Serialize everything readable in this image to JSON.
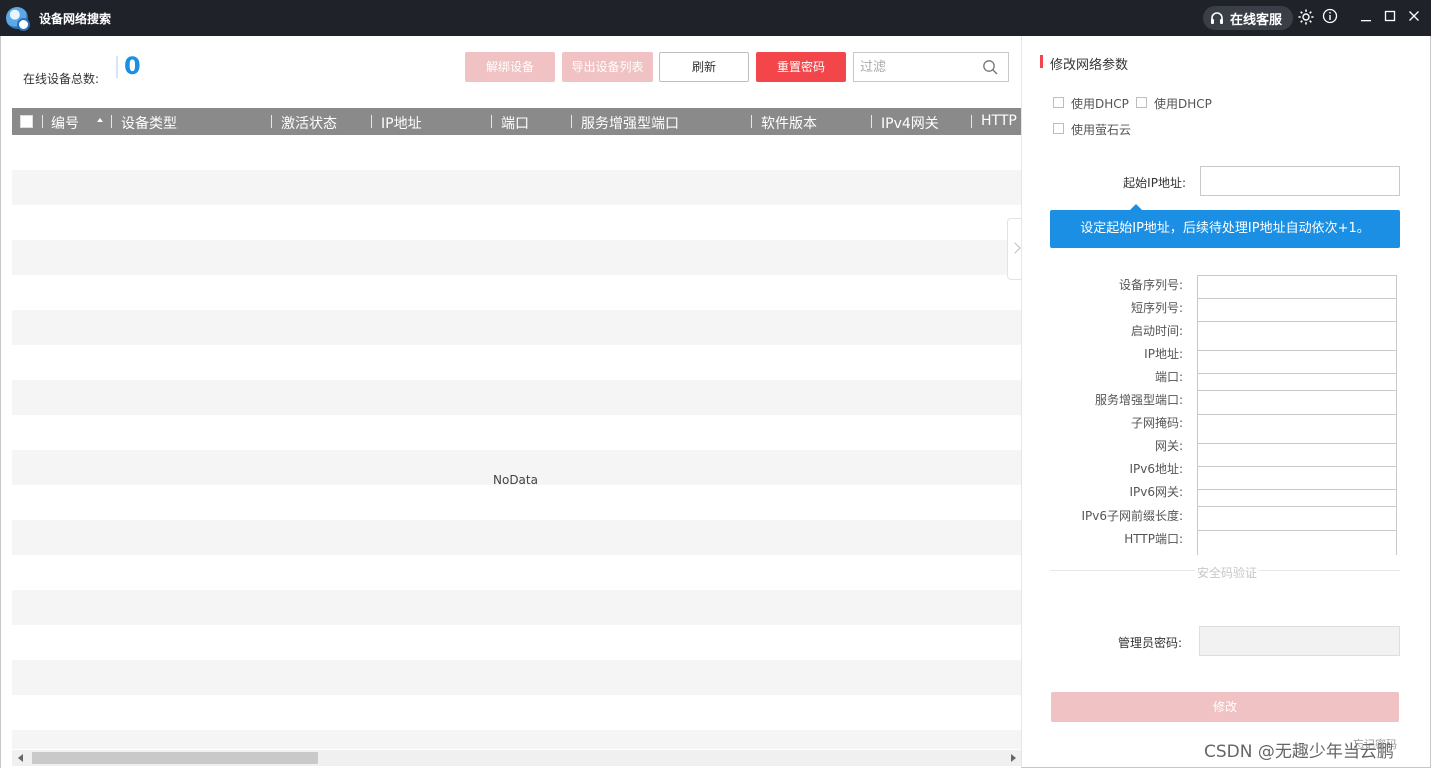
{
  "app": {
    "title": "设备网络搜索",
    "service_label": "在线客服"
  },
  "colors": {
    "accent_blue": "#1a8fe3",
    "danger_red": "#f2464a",
    "disabled_red": "#f0c2c4",
    "titlebar": "#1f2329"
  },
  "summary": {
    "label": "在线设备总数:",
    "count": "0"
  },
  "toolbar": {
    "unbind_label": "解绑设备",
    "export_label": "导出设备列表",
    "refresh_label": "刷新",
    "reset_label": "重置密码",
    "filter_placeholder": "过滤"
  },
  "table": {
    "columns": [
      "编号",
      "设备类型",
      "激活状态",
      "IP地址",
      "端口",
      "服务增强型端口",
      "软件版本",
      "IPv4网关",
      "HTTP"
    ],
    "empty_text": "NoData"
  },
  "panel": {
    "title": "修改网络参数",
    "dhcp1_label": "使用DHCP",
    "dhcp2_label": "使用DHCP",
    "ezviz_label": "使用萤石云",
    "start_ip_label": "起始IP地址:",
    "tip": "设定起始IP地址，后续待处理IP地址自动依次+1。",
    "fields": [
      "设备序列号:",
      "短序列号:",
      "启动时间:",
      "IP地址:",
      "端口:",
      "服务增强型端口:",
      "子网掩码:",
      "网关:",
      "IPv6地址:",
      "IPv6网关:",
      "IPv6子网前缀长度:",
      "HTTP端口:"
    ],
    "security_label": "安全码验证",
    "admin_pwd_label": "管理员密码:",
    "modify_label": "修改",
    "forgot_label": "忘记密码"
  },
  "watermark": "CSDN @无趣少年当云鹏"
}
